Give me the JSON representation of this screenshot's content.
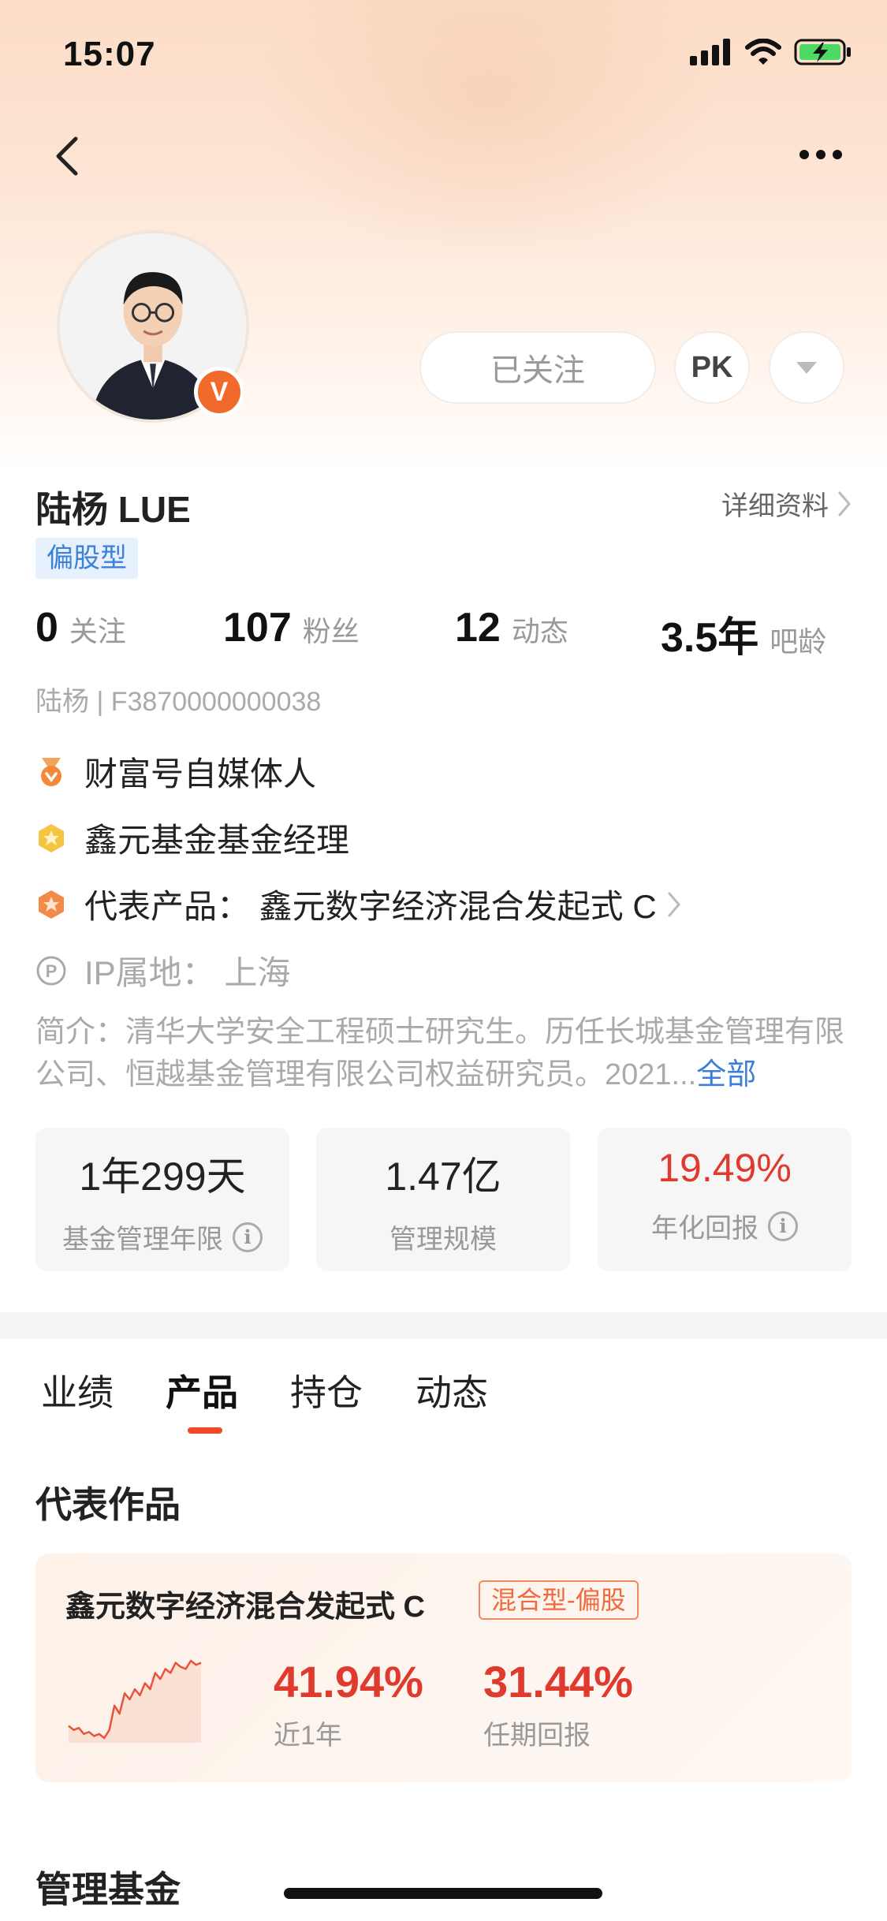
{
  "status": {
    "time": "15:07"
  },
  "colors": {
    "accent": "#f04a2b",
    "up_red": "#e03a2f",
    "tag_blue": "#3b82d6",
    "link_blue": "#3b7fd8"
  },
  "profile": {
    "name": "陆杨 LUE",
    "detail_link": "详细资料",
    "type_tag": "偏股型",
    "verified_badge": "V",
    "follow_button": "已关注",
    "pk_button": "PK",
    "uid_line": "陆杨 | F3870000000038"
  },
  "stats": [
    {
      "value": "0",
      "label": "关注"
    },
    {
      "value": "107",
      "label": "粉丝"
    },
    {
      "value": "12",
      "label": "动态"
    },
    {
      "value": "3.5年",
      "label": "吧龄"
    }
  ],
  "info": [
    {
      "icon": "medal-icon",
      "text": "财富号自媒体人"
    },
    {
      "icon": "gold-badge-icon",
      "text": "鑫元基金基金经理"
    },
    {
      "icon": "orange-badge-icon",
      "text": "代表产品： 鑫元数字经济混合发起式 C"
    },
    {
      "icon": "ip-icon",
      "text": "IP属地： 上海"
    }
  ],
  "intro": {
    "text": "简介：清华大学安全工程硕士研究生。历任长城基金管理有限公司、恒越基金管理有限公司权益研究员。2021...",
    "more": "全部"
  },
  "metrics": [
    {
      "value": "1年299天",
      "label": "基金管理年限",
      "info": true
    },
    {
      "value": "1.47亿",
      "label": "管理规模",
      "info": false
    },
    {
      "value": "19.49%",
      "label": "年化回报",
      "info": true
    }
  ],
  "tabs": [
    "业绩",
    "产品",
    "持仓",
    "动态"
  ],
  "active_tab": "产品",
  "sections": {
    "works_title": "代表作品",
    "managed_title": "管理基金"
  },
  "work": {
    "name": "鑫元数字经济混合发起式 C",
    "tag": "混合型-偏股",
    "return_1y": "41.94%",
    "return_1y_label": "近1年",
    "return_term": "31.44%",
    "return_term_label": "任期回报",
    "sparkline": [
      12,
      10,
      11,
      8,
      9,
      7,
      8,
      6,
      10,
      22,
      18,
      28,
      25,
      30,
      27,
      33,
      30,
      38,
      35,
      40,
      38,
      43,
      41,
      40,
      44,
      42,
      43
    ]
  }
}
